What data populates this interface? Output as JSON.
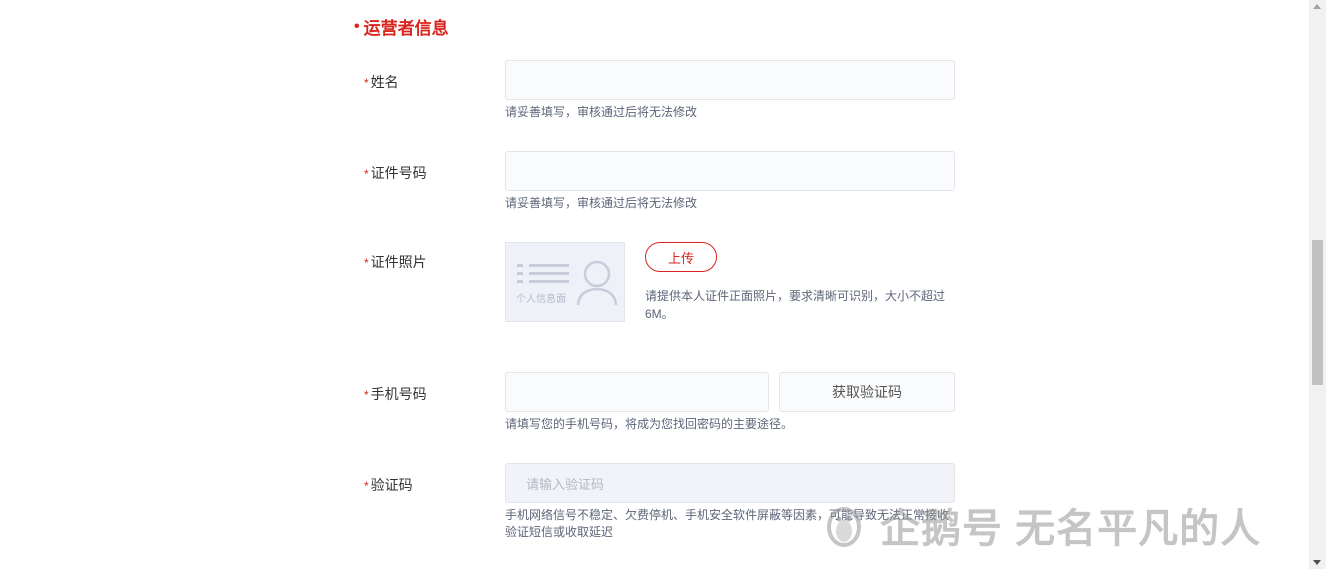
{
  "section": {
    "bullet": "•",
    "title": "运营者信息"
  },
  "required_mark": "*",
  "fields": {
    "name": {
      "label": "姓名",
      "value": "",
      "placeholder": "",
      "hint": "请妥善填写，审核通过后将无法修改"
    },
    "id_number": {
      "label": "证件号码",
      "value": "",
      "placeholder": "",
      "hint": "请妥善填写，审核通过后将无法修改"
    },
    "id_photo": {
      "label": "证件照片",
      "preview_caption": "个人信息面",
      "upload_label": "上传",
      "hint": "请提供本人证件正面照片，要求清晰可识别，大小不超过6M。"
    },
    "phone": {
      "label": "手机号码",
      "value": "",
      "placeholder": "",
      "get_code_label": "获取验证码",
      "hint": "请填写您的手机号码，将成为您找回密码的主要途径。"
    },
    "verify_code": {
      "label": "验证码",
      "placeholder": "请输入验证码",
      "hint": "手机网络信号不稳定、欠费停机、手机安全软件屏蔽等因素，可能导致无法正常接收验证短信或收取延迟"
    }
  },
  "watermark": {
    "text": "企鹅号 无名平凡的人",
    "icon": "penguin-icon"
  },
  "colors": {
    "accent": "#d9251d",
    "hint": "#5d6578",
    "input_border": "#e3e5ea"
  }
}
